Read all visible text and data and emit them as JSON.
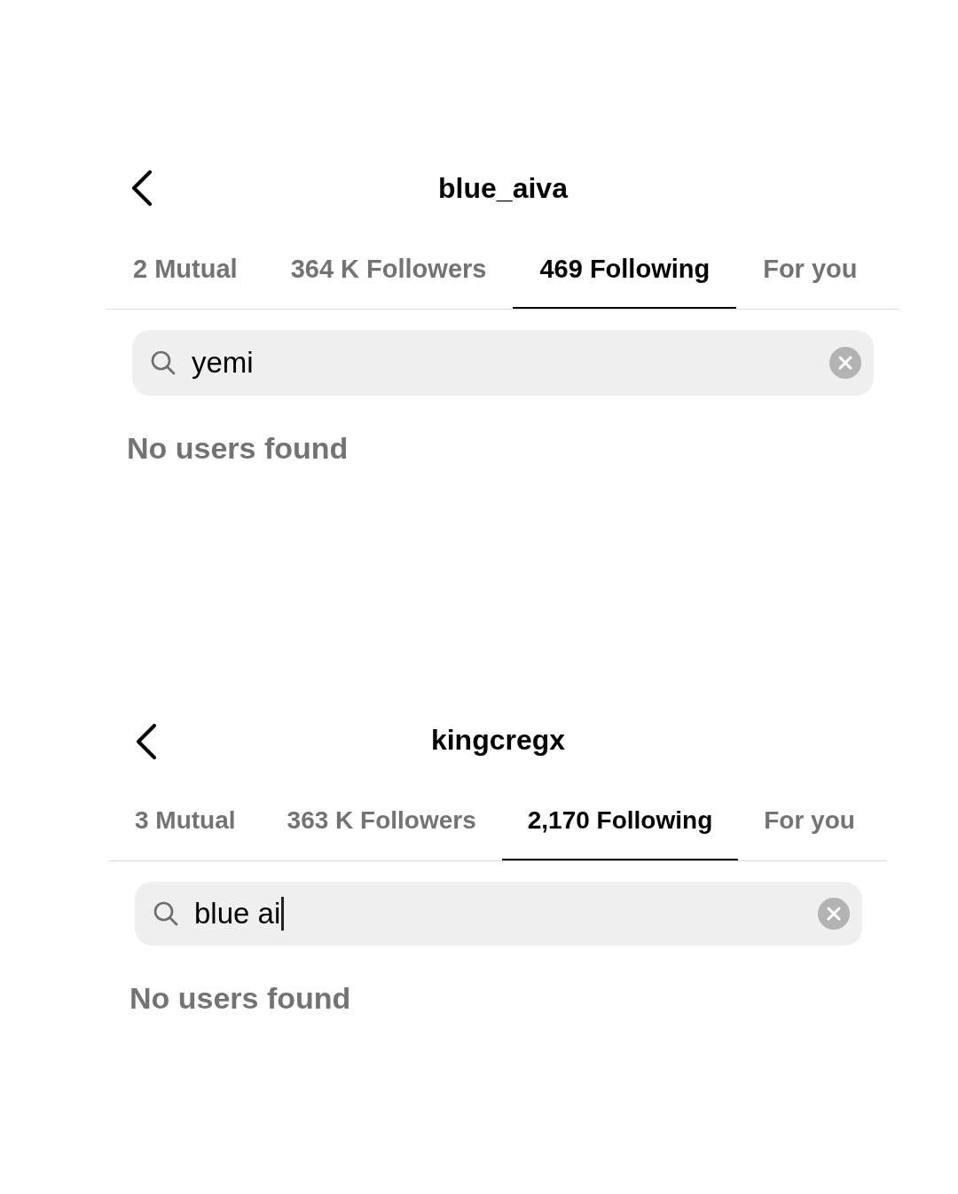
{
  "panels": [
    {
      "title": "blue_aiva",
      "tabs": [
        {
          "label": "2 Mutual",
          "selected": false
        },
        {
          "label": "364 K Followers",
          "selected": false
        },
        {
          "label": "469 Following",
          "selected": true
        },
        {
          "label": "For you",
          "selected": false
        }
      ],
      "search": {
        "value": "yemi",
        "focused": false
      },
      "message": "No users found"
    },
    {
      "title": "kingcregx",
      "tabs": [
        {
          "label": "3 Mutual",
          "selected": false
        },
        {
          "label": "363 K Followers",
          "selected": false
        },
        {
          "label": "2,170 Following",
          "selected": true
        },
        {
          "label": "For you",
          "selected": false
        }
      ],
      "search": {
        "value": "blue ai",
        "focused": true
      },
      "message": "No users found"
    }
  ]
}
